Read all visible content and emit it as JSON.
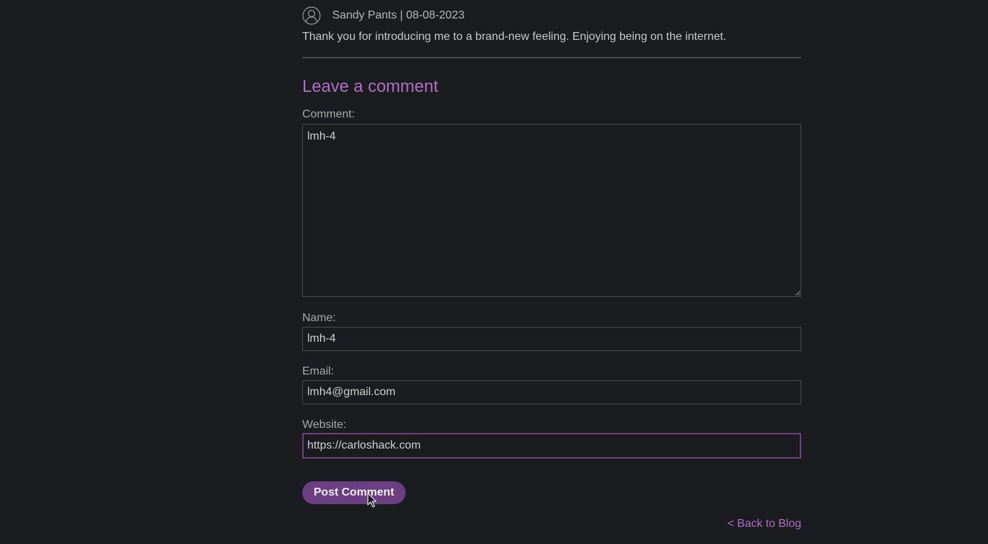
{
  "comment": {
    "author": "Sandy Pants",
    "date": "08-08-2023",
    "meta": "Sandy Pants | 08-08-2023",
    "body": "Thank you for introducing me to a brand-new feeling. Enjoying being on the internet.",
    "avatar_icon": "user-avatar-icon"
  },
  "form": {
    "title": "Leave a comment",
    "comment_label": "Comment:",
    "comment_value": "lmh-4",
    "name_label": "Name:",
    "name_value": "lmh-4",
    "email_label": "Email:",
    "email_value": "lmh4@gmail.com",
    "website_label": "Website:",
    "website_value": "https://carloshack.com",
    "submit_label": "Post Comment"
  },
  "nav": {
    "back_label": "< Back to Blog"
  },
  "colors": {
    "background": "#1b1c1f",
    "accent": "#b06fc4",
    "button": "#6c3f83"
  }
}
